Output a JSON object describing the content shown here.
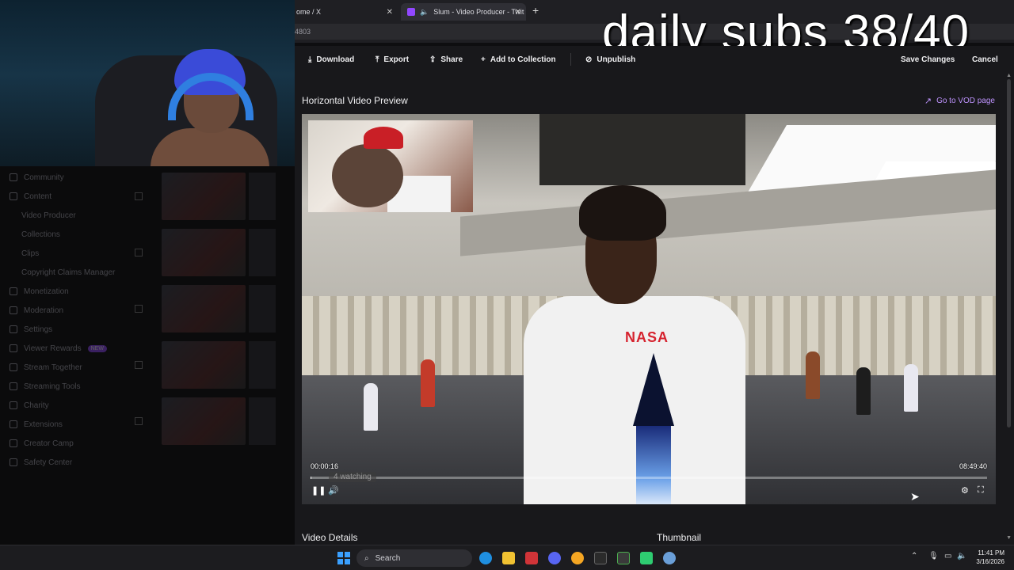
{
  "overlay": {
    "text": "daily subs 38/40"
  },
  "browser": {
    "tabs": [
      {
        "label": "ome / X"
      },
      {
        "label": "Slum - Video Producer - Twit"
      }
    ],
    "address_fragment": "4803"
  },
  "sidebar": {
    "items": [
      {
        "label": "Community",
        "kind": "section"
      },
      {
        "label": "Content",
        "kind": "section"
      },
      {
        "label": "Video Producer",
        "kind": "sub"
      },
      {
        "label": "Collections",
        "kind": "sub"
      },
      {
        "label": "Clips",
        "kind": "sub"
      },
      {
        "label": "Copyright Claims Manager",
        "kind": "sub"
      },
      {
        "label": "Monetization",
        "kind": "section"
      },
      {
        "label": "Moderation",
        "kind": "section"
      },
      {
        "label": "Settings",
        "kind": "section"
      },
      {
        "label": "Viewer Rewards",
        "kind": "section",
        "badge": "NEW"
      },
      {
        "label": "Stream Together",
        "kind": "section"
      },
      {
        "label": "Streaming Tools",
        "kind": "section"
      },
      {
        "label": "Charity",
        "kind": "section"
      },
      {
        "label": "Extensions",
        "kind": "section"
      },
      {
        "label": "Creator Camp",
        "kind": "section"
      },
      {
        "label": "Safety Center",
        "kind": "section"
      }
    ]
  },
  "toolbar": {
    "download": "Download",
    "export": "Export",
    "share": "Share",
    "add_to_collection": "Add to Collection",
    "unpublish": "Unpublish",
    "save_changes": "Save Changes",
    "cancel": "Cancel"
  },
  "preview": {
    "title": "Horizontal Video Preview",
    "vod_link": "Go to VOD page",
    "current_time": "00:00:16",
    "duration": "08:49:40",
    "watching": "4 watching",
    "progress_fraction": 0.0005,
    "shirt_text": "NASA"
  },
  "sections": {
    "details": "Video Details",
    "thumbnail": "Thumbnail"
  },
  "taskbar": {
    "search": "Search",
    "time": "11:41 PM",
    "date": "3/16/2026"
  },
  "colors": {
    "accent": "#9147ff",
    "link": "#bf94ff",
    "background": "#18181b"
  }
}
